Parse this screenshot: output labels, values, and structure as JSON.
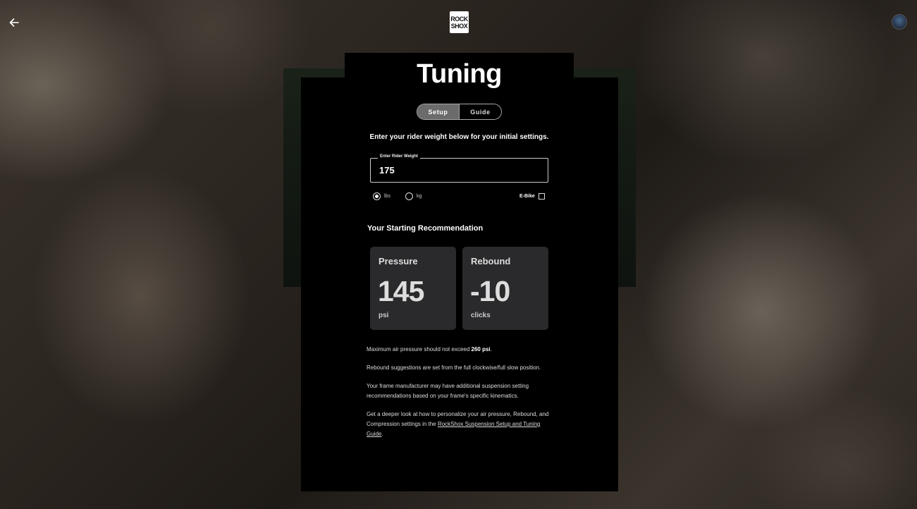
{
  "header": {
    "back_icon": "arrow-left-icon",
    "logo_line1": "ROCK",
    "logo_line2": "SHOX",
    "avatar_icon": "user-avatar"
  },
  "page": {
    "title": "Tuning",
    "tabs": [
      {
        "label": "Setup",
        "active": true
      },
      {
        "label": "Guide",
        "active": false
      }
    ],
    "intro": "Enter your rider weight below for your initial settings."
  },
  "weight": {
    "label": "Enter Rider Weight",
    "value": "175",
    "units": [
      {
        "label": "lbs",
        "selected": true
      },
      {
        "label": "kg",
        "selected": false
      }
    ],
    "ebike_label": "E-Bike",
    "ebike_checked": false
  },
  "recommendation": {
    "heading": "Your Starting Recommendation",
    "cards": [
      {
        "title": "Pressure",
        "value": "145",
        "unit": "psi"
      },
      {
        "title": "Rebound",
        "value": "-10",
        "unit": "clicks"
      }
    ]
  },
  "notes": {
    "max_pressure_prefix": "Maximum air pressure should not exceed ",
    "max_pressure_value": "260 psi",
    "max_pressure_suffix": ".",
    "rebound_note": "Rebound suggestions are set from the full clockwise/full slow position.",
    "frame_note": "Your frame manufacturer may have additional suspension setting recommendations based on your frame's specific kinematics.",
    "guide_prefix": "Get a deeper look at how to personalize your air pressure, Rebound, and Compression settings in the ",
    "guide_link": "RockShox Suspension Setup and Tuning Guide",
    "guide_suffix": "."
  },
  "colors": {
    "panel": "#000000",
    "card": "#2a2a2c",
    "active_tab": "#6b6b6b"
  }
}
